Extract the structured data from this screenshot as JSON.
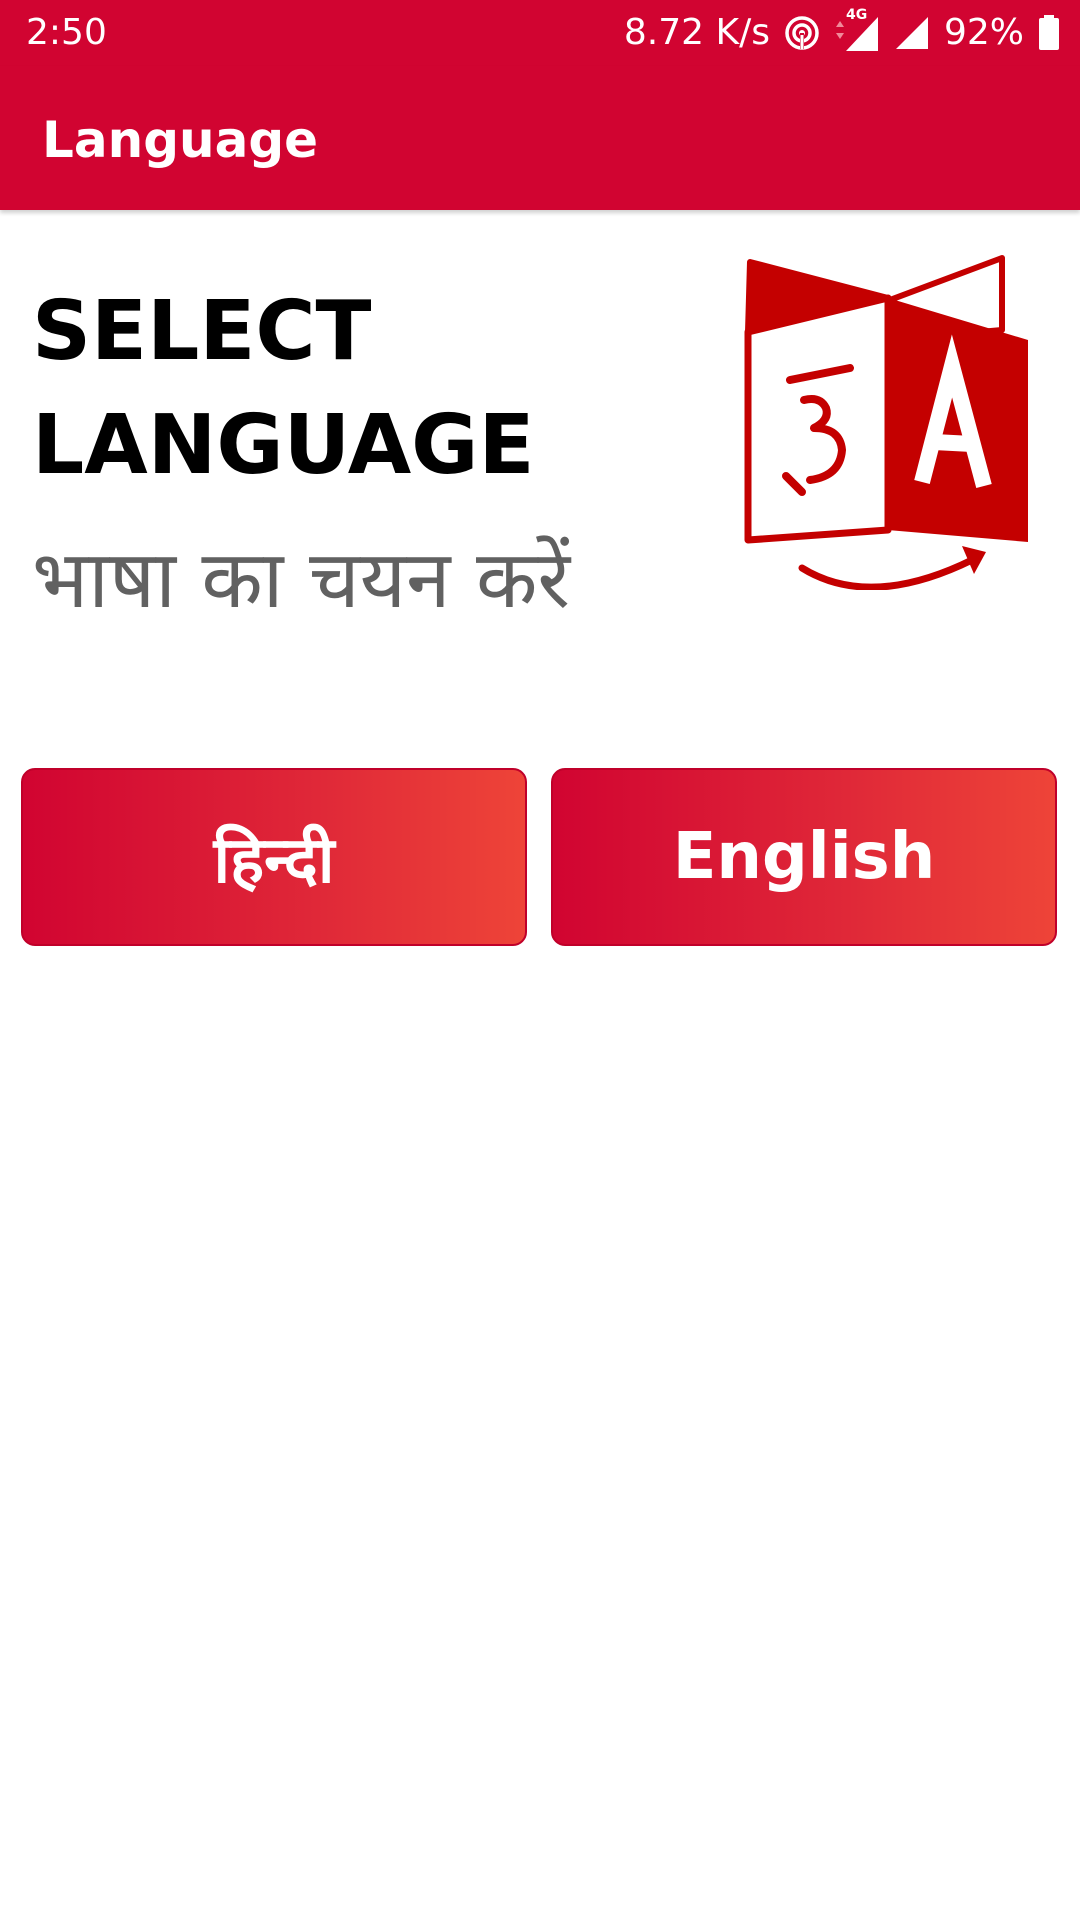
{
  "status_bar": {
    "time": "2:50",
    "speed": "8.72 K/s",
    "network_label": "4G",
    "battery": "92%",
    "icons": [
      "hotspot-icon",
      "signal-4g-icon",
      "signal-icon",
      "battery-icon"
    ]
  },
  "app_bar": {
    "title": "Language"
  },
  "content": {
    "heading_line1": "SELECT",
    "heading_line2": "LANGUAGE",
    "heading_hindi": "भाषा का चयन करें",
    "icon": "translate-icon"
  },
  "buttons": {
    "hindi_label": "हिन्दी",
    "english_label": "English"
  },
  "colors": {
    "primary": "#d10431",
    "gradient_end": "#ee4438",
    "heading": "#000000",
    "subheading": "#616161"
  }
}
